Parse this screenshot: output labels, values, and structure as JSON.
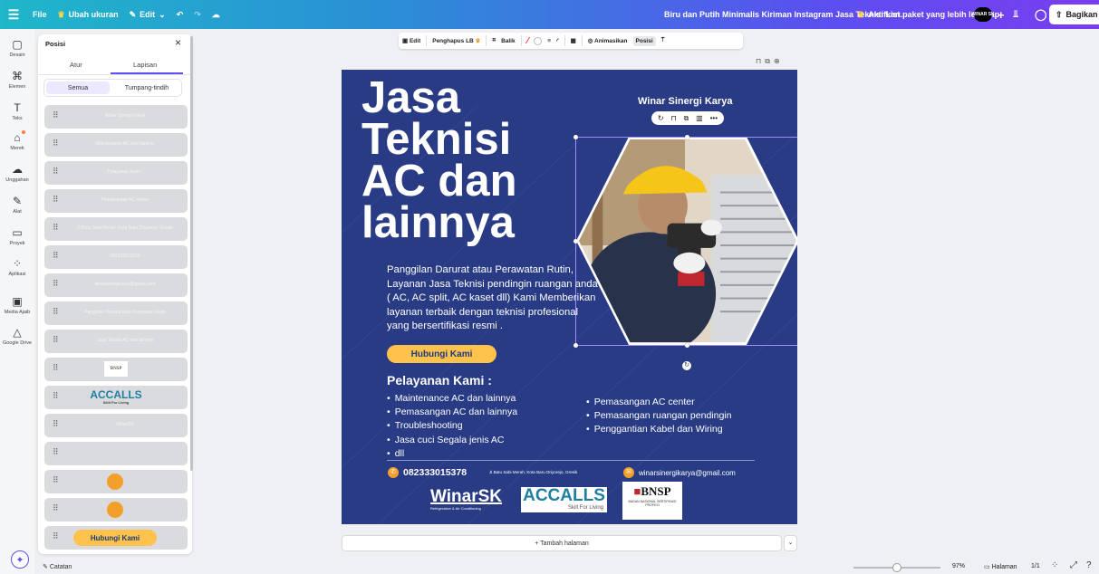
{
  "topbar": {
    "menu_icon": "hamburger-icon",
    "file": "File",
    "resize": "Ubah ukuran",
    "edit": "Edit",
    "doc_title": "Biru dan Putih Minimalis Kiriman Instagram Jasa Teknisi List...",
    "upgrade": "Aktifkan paket yang lebih lengkap",
    "avatar_text": "WINAR SK",
    "share": "Bagikan"
  },
  "rail": {
    "items": [
      {
        "label": "Desain",
        "icon": "design-icon"
      },
      {
        "label": "Elemen",
        "icon": "elements-icon"
      },
      {
        "label": "Teks",
        "icon": "text-icon"
      },
      {
        "label": "Merek",
        "icon": "brand-icon"
      },
      {
        "label": "Unggahan",
        "icon": "upload-icon"
      },
      {
        "label": "Alat",
        "icon": "draw-icon"
      },
      {
        "label": "Proyek",
        "icon": "folder-icon"
      },
      {
        "label": "Aplikasi",
        "icon": "apps-icon"
      },
      {
        "label": "Media Ajaib",
        "icon": "magic-media-icon"
      },
      {
        "label": "Google Drive",
        "icon": "google-drive-icon"
      }
    ]
  },
  "panel": {
    "title": "Posisi",
    "tabs": [
      "Atur",
      "Lapisan"
    ],
    "active_tab": "Lapisan",
    "filters": [
      "Semua",
      "Tumpang-tindih"
    ],
    "active_filter": "Semua",
    "layers": [
      {
        "kind": "text",
        "text": "Winar Sinergi Karya"
      },
      {
        "kind": "text",
        "text": "Maintenance AC dan lainnya"
      },
      {
        "kind": "text",
        "text": "Pelayanan Kami :"
      },
      {
        "kind": "text",
        "text": "Pemasangan AC center"
      },
      {
        "kind": "text",
        "text": "Jl.Batu Sabi Merah, Kota Baru Driyorejo, Gresik"
      },
      {
        "kind": "text",
        "text": "082333015378"
      },
      {
        "kind": "text",
        "text": "winarsinergikarya@gmail.com"
      },
      {
        "kind": "text",
        "text": "Panggilan Darurat atau Perawatan Rutin"
      },
      {
        "kind": "text",
        "text": "Jasa Teknisi AC dan lainnya"
      },
      {
        "kind": "bnsp",
        "text": "BNSP"
      },
      {
        "kind": "accalls",
        "text": "ACCALLS",
        "sub": "Skill For Living"
      },
      {
        "kind": "text",
        "text": "WinarSK"
      },
      {
        "kind": "text",
        "text": ""
      },
      {
        "kind": "orange",
        "text": ""
      },
      {
        "kind": "orange",
        "text": ""
      },
      {
        "kind": "button",
        "text": "Hubungi Kami"
      }
    ]
  },
  "toolbar": {
    "edit": "Edit",
    "bg_remover": "Penghapus LB",
    "flip": "Balik",
    "animate": "Animasikan",
    "position": "Posisi"
  },
  "design": {
    "headline": [
      "Jasa",
      "Teknisi",
      "AC dan",
      "lainnya"
    ],
    "company": "Winar Sinergi Karya",
    "intro": "Panggilan Darurat atau Perawatan Rutin, Layanan Jasa Teknisi pendingin ruangan anda ( AC, AC split, AC kaset dll) Kami Memberikan layanan terbaik dengan teknisi profesional yang bersertifikasi resmi .",
    "cta": "Hubungi Kami",
    "services_title": "Pelayanan Kami :",
    "services_left": [
      "Maintenance AC dan lainnya",
      "Pemasangan AC dan lainnya",
      "Troubleshooting",
      "Jasa cuci Segala jenis AC",
      "dll"
    ],
    "services_right": [
      "Pemasangan AC center",
      "Pemasangan ruangan pendingin",
      "Penggantian Kabel dan Wiring"
    ],
    "phone": "082333015378",
    "address": "Jl.Batu Sabi Merah, Kota Baru Driyorejo, Gresik",
    "email": "winarsinergikarya@gmail.com",
    "logo_winar": "WinarSK",
    "logo_winar_sub": "Refrigeration & Air Conditioning",
    "logo_accalls": "ACCALLS",
    "logo_accalls_sub": "Skill For Living",
    "logo_bnsp": "BNSP",
    "logo_bnsp_sub": "BADAN NASIONAL SERTIFIKASI PROFESI",
    "colors": {
      "background": "#283b84",
      "accent": "#ffc24d",
      "icon": "#f3a02b"
    }
  },
  "bottom": {
    "add_page": "+ Tambah halaman",
    "notes": "Catatan",
    "zoom": "97%",
    "zoom_fraction": 0.5,
    "pages_label": "Halaman",
    "page_count": "1/1"
  }
}
